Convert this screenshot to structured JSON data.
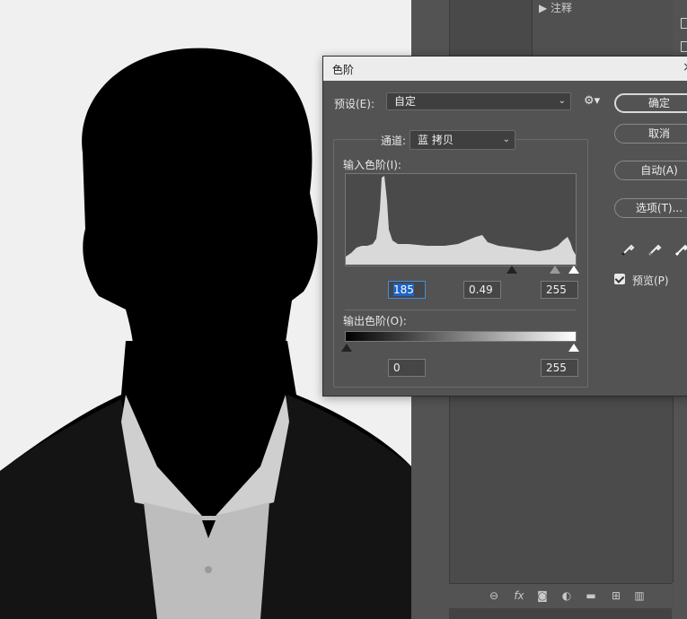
{
  "dialog": {
    "title": "色阶",
    "preset_label": "预设(E):",
    "preset_value": "自定",
    "channel_label": "通道:",
    "channel_value": "蓝 拷贝",
    "input_levels_label": "输入色阶(I):",
    "input_shadow": "185",
    "input_midtone": "0.49",
    "input_highlight": "255",
    "output_levels_label": "输出色阶(O):",
    "output_shadow": "0",
    "output_highlight": "255",
    "buttons": {
      "ok": "确定",
      "cancel": "取消",
      "auto": "自动(A)",
      "options": "选项(T)..."
    },
    "preview_label": "预览(P)",
    "preview_checked": true,
    "close_glyph": "×",
    "settings_glyph": "⚙"
  },
  "colors": {
    "dialog_bg": "#535353",
    "title_bg": "#ececec",
    "accent": "#1d64c8"
  },
  "right_panel": {
    "top_tab": "▶ 注释"
  },
  "layers_footer_icons": [
    "link-icon",
    "fx-icon",
    "mask-icon",
    "adjustment-icon",
    "folder-icon",
    "new-layer-icon",
    "trash-icon"
  ]
}
